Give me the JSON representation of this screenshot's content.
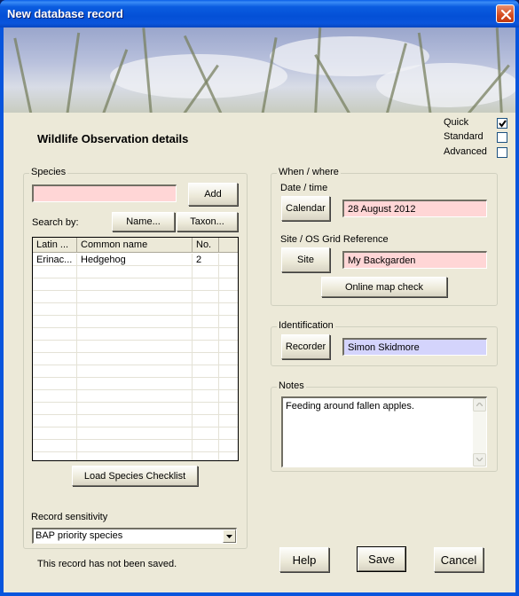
{
  "window": {
    "title": "New database record",
    "close_icon": "close-x-icon"
  },
  "header": {
    "title": "Wildlife Observation details"
  },
  "modes": [
    {
      "label": "Quick",
      "checked": true
    },
    {
      "label": "Standard",
      "checked": false
    },
    {
      "label": "Advanced",
      "checked": false
    }
  ],
  "species": {
    "group_label": "Species",
    "input_value": "",
    "add_label": "Add",
    "search_by_label": "Search by:",
    "name_button": "Name...",
    "taxon_button": "Taxon...",
    "columns": [
      "Latin ...",
      "Common name",
      "No.",
      ""
    ],
    "rows": [
      [
        "Erinac...",
        "Hedgehog",
        "2",
        ""
      ]
    ],
    "load_checklist_label": "Load Species Checklist",
    "sensitivity_label": "Record sensitivity",
    "sensitivity_value": "BAP priority species"
  },
  "when_where": {
    "group_label": "When / where",
    "date_label": "Date / time",
    "calendar_button": "Calendar",
    "date_value": "28 August 2012",
    "site_label": "Site / OS Grid Reference",
    "site_button": "Site",
    "site_value": "My Backgarden",
    "map_check_button": "Online map check"
  },
  "identification": {
    "group_label": "Identification",
    "recorder_button": "Recorder",
    "recorder_value": "Simon Skidmore"
  },
  "notes": {
    "group_label": "Notes",
    "text": "Feeding around fallen apples."
  },
  "status": {
    "text": "This record has not been saved."
  },
  "footer": {
    "help_label": "Help",
    "save_label": "Save",
    "cancel_label": "Cancel"
  },
  "colors": {
    "required_field": "#ffd6d6",
    "recorder_field": "#d4d4fc",
    "title_bar": "#0855dd",
    "dialog_bg": "#ece9d8"
  }
}
